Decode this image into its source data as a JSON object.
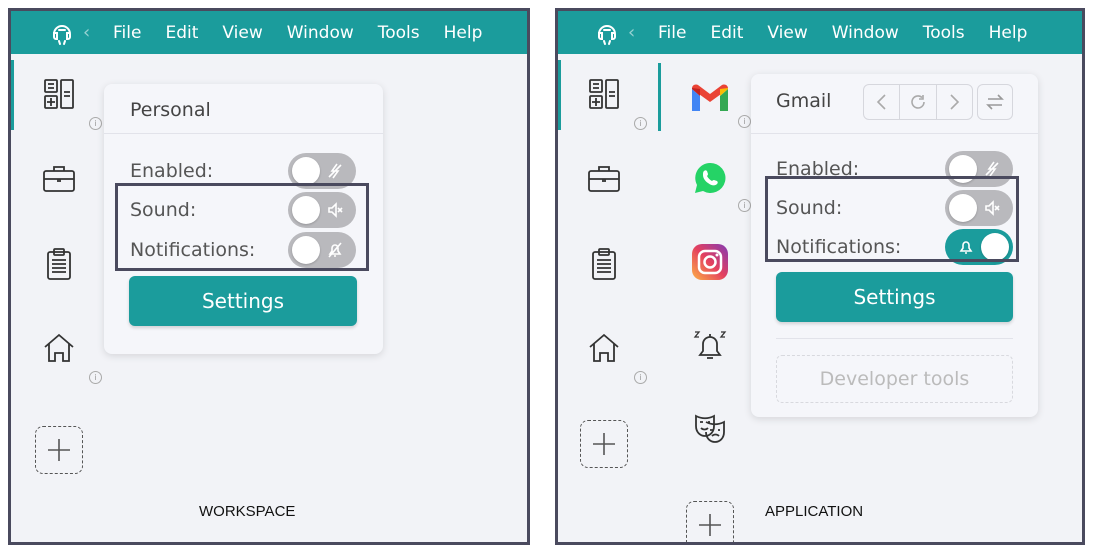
{
  "menu": [
    "File",
    "Edit",
    "View",
    "Window",
    "Tools",
    "Help"
  ],
  "workspace": {
    "caption": "WORKSPACE",
    "popover": {
      "title": "Personal",
      "enabled_label": "Enabled:",
      "sound_label": "Sound:",
      "notifications_label": "Notifications:",
      "settings_label": "Settings",
      "toggles": {
        "enabled": false,
        "sound": false,
        "notifications": false
      }
    }
  },
  "application": {
    "caption": "APPLICATION",
    "popover": {
      "title": "Gmail",
      "enabled_label": "Enabled:",
      "sound_label": "Sound:",
      "notifications_label": "Notifications:",
      "settings_label": "Settings",
      "developer_tools_label": "Developer tools",
      "toggles": {
        "enabled": false,
        "sound": false,
        "notifications": true
      }
    }
  },
  "colors": {
    "accent": "#1b9c9c",
    "frame": "#4a4a5e",
    "background": "#f2f3f7"
  }
}
